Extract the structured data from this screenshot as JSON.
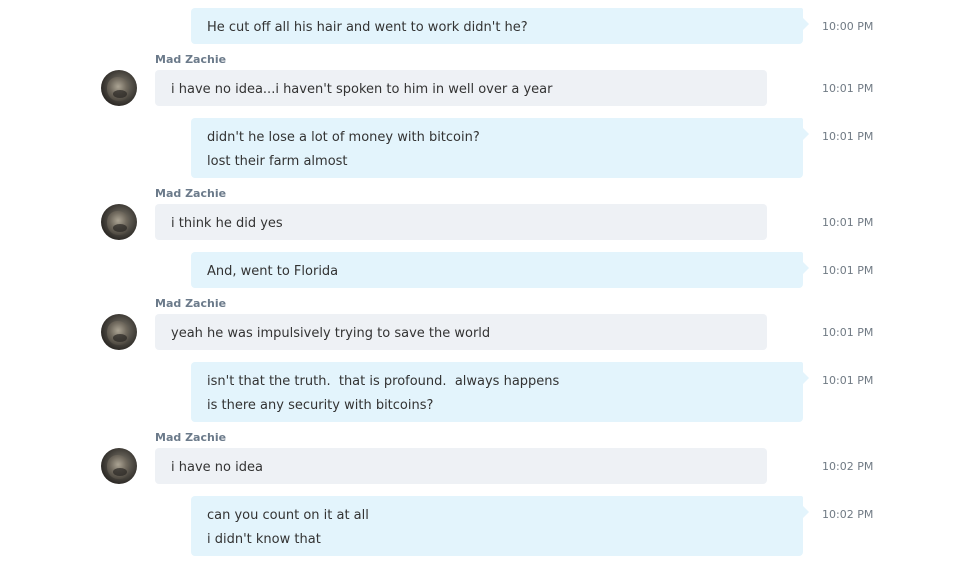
{
  "messages": [
    {
      "direction": "out",
      "lines": [
        "He cut off all his hair and went to work didn't he?"
      ],
      "time": "10:00 PM"
    },
    {
      "direction": "in",
      "sender": "Mad Zachie",
      "lines": [
        "i have no idea...i haven't spoken to him in well over a year"
      ],
      "time": "10:01 PM"
    },
    {
      "direction": "out",
      "lines": [
        "didn't he lose a lot of money with bitcoin?",
        "lost their farm almost"
      ],
      "time": "10:01 PM"
    },
    {
      "direction": "in",
      "sender": "Mad Zachie",
      "lines": [
        "i think he did yes"
      ],
      "time": "10:01 PM"
    },
    {
      "direction": "out",
      "lines": [
        "And, went to Florida"
      ],
      "time": "10:01 PM"
    },
    {
      "direction": "in",
      "sender": "Mad Zachie",
      "lines": [
        "yeah he was impulsively trying to save the world"
      ],
      "time": "10:01 PM"
    },
    {
      "direction": "out",
      "lines": [
        "isn't that the truth.  that is profound.  always happens",
        "is there any security with bitcoins?"
      ],
      "time": "10:01 PM"
    },
    {
      "direction": "in",
      "sender": "Mad Zachie",
      "lines": [
        "i have no idea"
      ],
      "time": "10:02 PM"
    },
    {
      "direction": "out",
      "lines": [
        "can you count on it at all",
        "i didn't know that"
      ],
      "time": "10:02 PM"
    }
  ]
}
